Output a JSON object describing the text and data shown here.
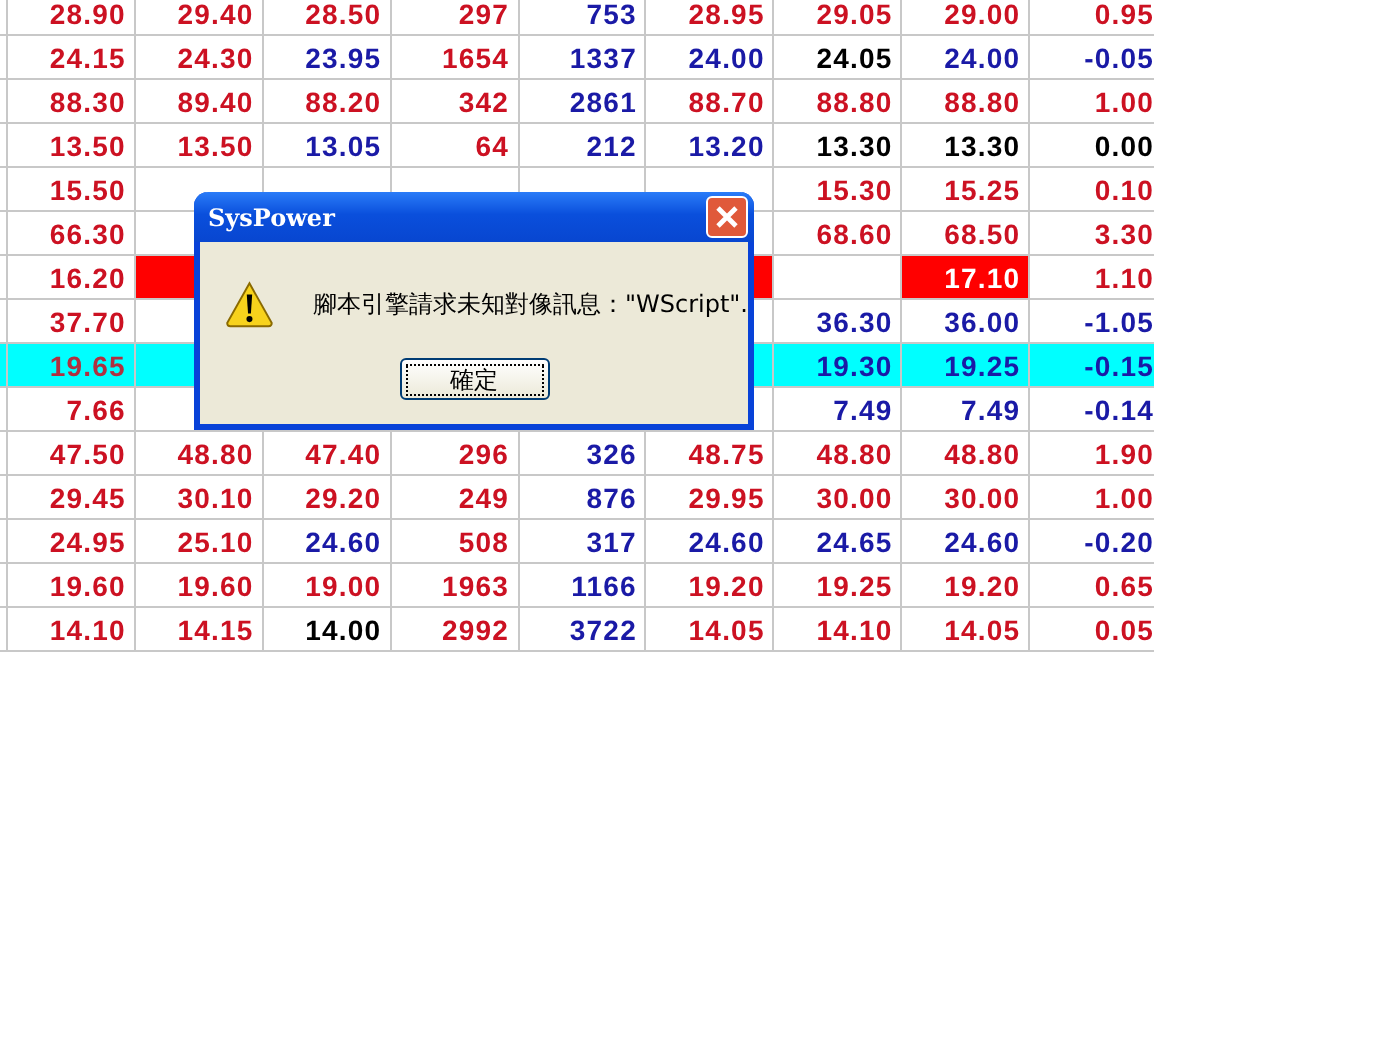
{
  "table": {
    "rows": [
      {
        "selected": false,
        "cells": [
          {
            "text": "28.90",
            "color": "#cc1122"
          },
          {
            "text": "29.40",
            "color": "#cc1122"
          },
          {
            "text": "28.50",
            "color": "#cc1122"
          },
          {
            "text": "297",
            "color": "#cc1122"
          },
          {
            "text": "753",
            "color": "#1a1aa6"
          },
          {
            "text": "28.95",
            "color": "#cc1122"
          },
          {
            "text": "29.05",
            "color": "#cc1122"
          },
          {
            "text": "29.00",
            "color": "#cc1122"
          },
          {
            "text": "0.95",
            "color": "#cc1122"
          }
        ]
      },
      {
        "selected": false,
        "cells": [
          {
            "text": "24.15",
            "color": "#cc1122"
          },
          {
            "text": "24.30",
            "color": "#cc1122"
          },
          {
            "text": "23.95",
            "color": "#1a1aa6"
          },
          {
            "text": "1654",
            "color": "#cc1122"
          },
          {
            "text": "1337",
            "color": "#1a1aa6"
          },
          {
            "text": "24.00",
            "color": "#1a1aa6"
          },
          {
            "text": "24.05",
            "color": "#000000"
          },
          {
            "text": "24.00",
            "color": "#1a1aa6"
          },
          {
            "text": "-0.05",
            "color": "#1a1aa6"
          }
        ]
      },
      {
        "selected": false,
        "cells": [
          {
            "text": "88.30",
            "color": "#cc1122"
          },
          {
            "text": "89.40",
            "color": "#cc1122"
          },
          {
            "text": "88.20",
            "color": "#cc1122"
          },
          {
            "text": "342",
            "color": "#cc1122"
          },
          {
            "text": "2861",
            "color": "#1a1aa6"
          },
          {
            "text": "88.70",
            "color": "#cc1122"
          },
          {
            "text": "88.80",
            "color": "#cc1122"
          },
          {
            "text": "88.80",
            "color": "#cc1122"
          },
          {
            "text": "1.00",
            "color": "#cc1122"
          }
        ]
      },
      {
        "selected": false,
        "cells": [
          {
            "text": "13.50",
            "color": "#cc1122"
          },
          {
            "text": "13.50",
            "color": "#cc1122"
          },
          {
            "text": "13.05",
            "color": "#1a1aa6"
          },
          {
            "text": "64",
            "color": "#cc1122"
          },
          {
            "text": "212",
            "color": "#1a1aa6"
          },
          {
            "text": "13.20",
            "color": "#1a1aa6"
          },
          {
            "text": "13.30",
            "color": "#000000"
          },
          {
            "text": "13.30",
            "color": "#000000"
          },
          {
            "text": "0.00",
            "color": "#000000"
          }
        ]
      },
      {
        "selected": false,
        "cells": [
          {
            "text": "15.50",
            "color": "#cc1122"
          },
          null,
          null,
          null,
          null,
          null,
          {
            "text": "15.30",
            "color": "#cc1122"
          },
          {
            "text": "15.25",
            "color": "#cc1122"
          },
          {
            "text": "0.10",
            "color": "#cc1122"
          }
        ]
      },
      {
        "selected": false,
        "cells": [
          {
            "text": "66.30",
            "color": "#cc1122"
          },
          null,
          null,
          null,
          null,
          null,
          {
            "text": "68.60",
            "color": "#cc1122"
          },
          {
            "text": "68.50",
            "color": "#cc1122"
          },
          {
            "text": "3.30",
            "color": "#cc1122"
          }
        ]
      },
      {
        "selected": false,
        "cells": [
          {
            "text": "16.20",
            "color": "#cc1122"
          },
          {
            "highlighted": true
          },
          null,
          null,
          null,
          {
            "highlighted": true
          },
          null,
          {
            "text": "17.10",
            "color": "#ffffff",
            "highlighted": true
          },
          {
            "text": "1.10",
            "color": "#cc1122"
          }
        ]
      },
      {
        "selected": false,
        "cells": [
          {
            "text": "37.70",
            "color": "#cc1122"
          },
          null,
          null,
          null,
          null,
          null,
          {
            "text": "36.30",
            "color": "#1a1aa6"
          },
          {
            "text": "36.00",
            "color": "#1a1aa6"
          },
          {
            "text": "-1.05",
            "color": "#1a1aa6"
          }
        ]
      },
      {
        "selected": true,
        "cells": [
          {
            "text": "19.65",
            "color": "#b03040"
          },
          null,
          null,
          null,
          null,
          null,
          {
            "text": "19.30",
            "color": "#1a1aa6"
          },
          {
            "text": "19.25",
            "color": "#1a1aa6"
          },
          {
            "text": "-0.15",
            "color": "#1a1aa6"
          }
        ]
      },
      {
        "selected": false,
        "cells": [
          {
            "text": "7.66",
            "color": "#cc1122"
          },
          null,
          null,
          null,
          null,
          null,
          {
            "text": "7.49",
            "color": "#1a1aa6"
          },
          {
            "text": "7.49",
            "color": "#1a1aa6"
          },
          {
            "text": "-0.14",
            "color": "#1a1aa6"
          }
        ]
      },
      {
        "selected": false,
        "cells": [
          {
            "text": "47.50",
            "color": "#cc1122"
          },
          {
            "text": "48.80",
            "color": "#cc1122"
          },
          {
            "text": "47.40",
            "color": "#cc1122"
          },
          {
            "text": "296",
            "color": "#cc1122"
          },
          {
            "text": "326",
            "color": "#1a1aa6"
          },
          {
            "text": "48.75",
            "color": "#cc1122"
          },
          {
            "text": "48.80",
            "color": "#cc1122"
          },
          {
            "text": "48.80",
            "color": "#cc1122"
          },
          {
            "text": "1.90",
            "color": "#cc1122"
          }
        ]
      },
      {
        "selected": false,
        "cells": [
          {
            "text": "29.45",
            "color": "#cc1122"
          },
          {
            "text": "30.10",
            "color": "#cc1122"
          },
          {
            "text": "29.20",
            "color": "#cc1122"
          },
          {
            "text": "249",
            "color": "#cc1122"
          },
          {
            "text": "876",
            "color": "#1a1aa6"
          },
          {
            "text": "29.95",
            "color": "#cc1122"
          },
          {
            "text": "30.00",
            "color": "#cc1122"
          },
          {
            "text": "30.00",
            "color": "#cc1122"
          },
          {
            "text": "1.00",
            "color": "#cc1122"
          }
        ]
      },
      {
        "selected": false,
        "cells": [
          {
            "text": "24.95",
            "color": "#cc1122"
          },
          {
            "text": "25.10",
            "color": "#cc1122"
          },
          {
            "text": "24.60",
            "color": "#1a1aa6"
          },
          {
            "text": "508",
            "color": "#cc1122"
          },
          {
            "text": "317",
            "color": "#1a1aa6"
          },
          {
            "text": "24.60",
            "color": "#1a1aa6"
          },
          {
            "text": "24.65",
            "color": "#1a1aa6"
          },
          {
            "text": "24.60",
            "color": "#1a1aa6"
          },
          {
            "text": "-0.20",
            "color": "#1a1aa6"
          }
        ]
      },
      {
        "selected": false,
        "cells": [
          {
            "text": "19.60",
            "color": "#cc1122"
          },
          {
            "text": "19.60",
            "color": "#cc1122"
          },
          {
            "text": "19.00",
            "color": "#cc1122"
          },
          {
            "text": "1963",
            "color": "#cc1122"
          },
          {
            "text": "1166",
            "color": "#1a1aa6"
          },
          {
            "text": "19.20",
            "color": "#cc1122"
          },
          {
            "text": "19.25",
            "color": "#cc1122"
          },
          {
            "text": "19.20",
            "color": "#cc1122"
          },
          {
            "text": "0.65",
            "color": "#cc1122"
          }
        ]
      },
      {
        "selected": false,
        "cells": [
          {
            "text": "14.10",
            "color": "#cc1122"
          },
          {
            "text": "14.15",
            "color": "#cc1122"
          },
          {
            "text": "14.00",
            "color": "#000000"
          },
          {
            "text": "2992",
            "color": "#cc1122"
          },
          {
            "text": "3722",
            "color": "#1a1aa6"
          },
          {
            "text": "14.05",
            "color": "#cc1122"
          },
          {
            "text": "14.10",
            "color": "#cc1122"
          },
          {
            "text": "14.05",
            "color": "#cc1122"
          },
          {
            "text": "0.05",
            "color": "#cc1122"
          }
        ]
      }
    ]
  },
  "dialog": {
    "title": "SysPower",
    "message": "腳本引擎請求未知對像訊息：\"WScript\".",
    "buttons": [
      "確定"
    ]
  }
}
